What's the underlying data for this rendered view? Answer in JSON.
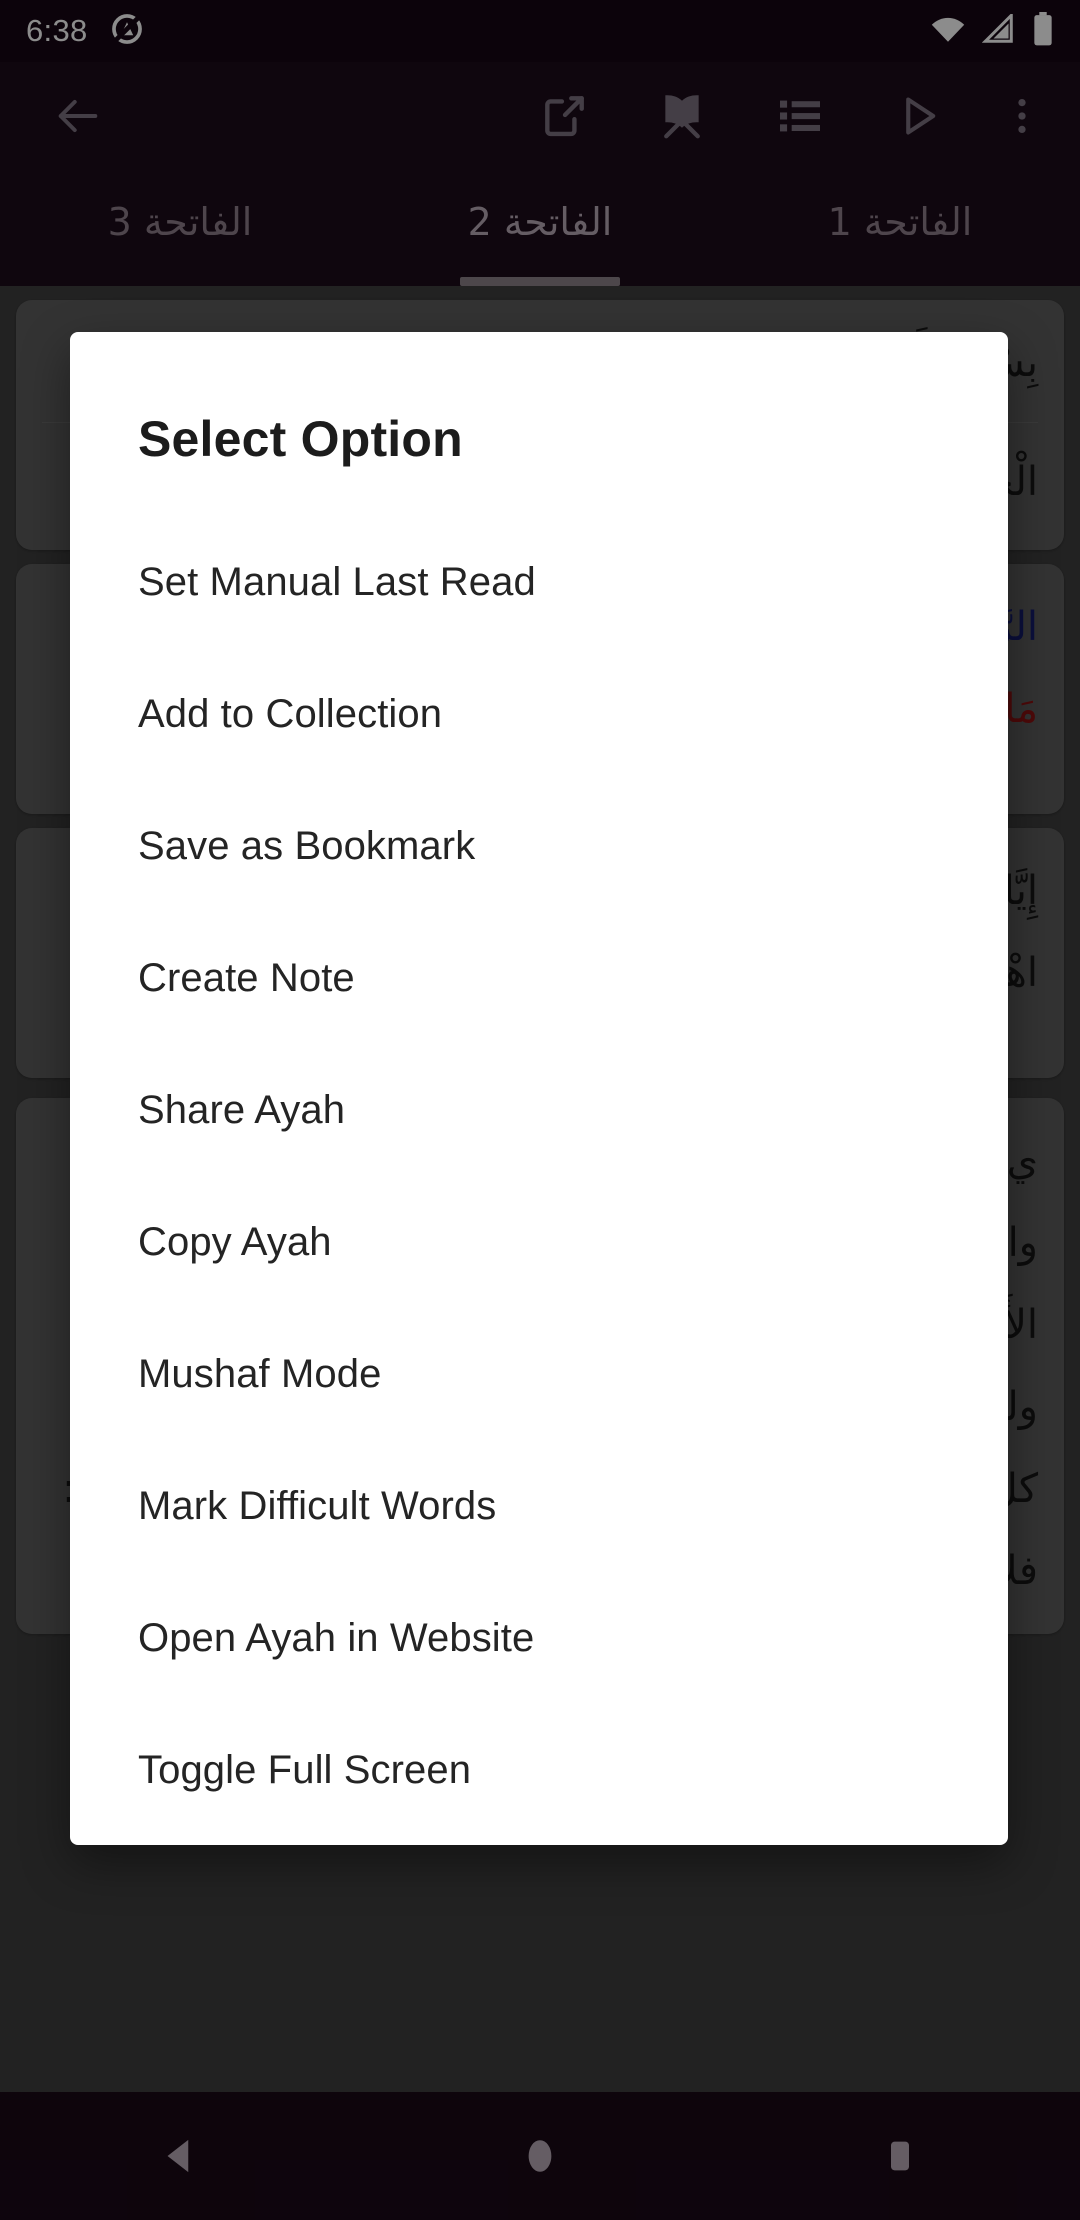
{
  "status_bar": {
    "time": "6:38",
    "notification_icon": "app-logo-notification-icon",
    "wifi_icon": "wifi-icon",
    "cellular_icon": "cellular-signal-icon",
    "battery_icon": "battery-full-icon"
  },
  "toolbar": {
    "back_label": "back-arrow-icon",
    "share_label": "share-icon",
    "book_label": "quran-book-icon",
    "list_label": "list-icon",
    "play_label": "play-icon",
    "more_label": "overflow-menu-icon"
  },
  "tabs": {
    "items": [
      {
        "label": "الفاتحة 1",
        "selected": false
      },
      {
        "label": "الفاتحة 2",
        "selected": true
      },
      {
        "label": "الفاتحة 3",
        "selected": false
      }
    ]
  },
  "content": {
    "cards": [
      {
        "lines": [
          "بِسْمِ اللَّهِ الرَّحْمَٰنِ الرَّحِيمِ",
          "الْحَمْدُ لِلَّهِ رَبِّ الْعَالَمِينَ"
        ]
      },
      {
        "lines": [
          "الرَّحْمَٰنِ الرَّحِيمِ ۝",
          "مَالِكِ يَوْمِ الدِّينِ ۝"
        ]
      },
      {
        "lines": [
          "إِيَّاكَ نَعْبُدُ وَإِيَّاكَ نَسْتَعِينُ",
          "اهْدِنَا الصِّرَاطَ الْمُسْتَقِيمَ"
        ]
      },
      {
        "lines": [
          "ي دون",
          "والحمد وجهه، وخالق و",
          "الأَول، والشُّكْرُ لا يقال إلا في مقابلة نعمة، فكلّ شكر حمد، وليس",
          "كل حمد شكرا، وكل حمد مدح وليس كل مدح حمدا، ويقال : فلان"
        ]
      }
    ]
  },
  "dialog": {
    "title": "Select Option",
    "options": [
      "Set Manual Last Read",
      "Add to Collection",
      "Save as Bookmark",
      "Create Note",
      "Share Ayah",
      "Copy Ayah",
      "Mushaf Mode",
      "Mark Difficult Words",
      "Open Ayah in Website",
      "Toggle Full Screen"
    ]
  },
  "nav_bar": {
    "back_label": "nav-back-icon",
    "home_label": "nav-home-icon",
    "recents_label": "nav-recents-icon"
  },
  "colors": {
    "app_bar": "#1d0b1a",
    "status_bar": "#170715",
    "dialog_bg": "#ffffff",
    "scrim": "rgba(0,0,0,0.45)",
    "tab_selected": "#b9aab6",
    "tab_unselected": "#8e7f8b",
    "nav_bar": "#1a0a17"
  }
}
